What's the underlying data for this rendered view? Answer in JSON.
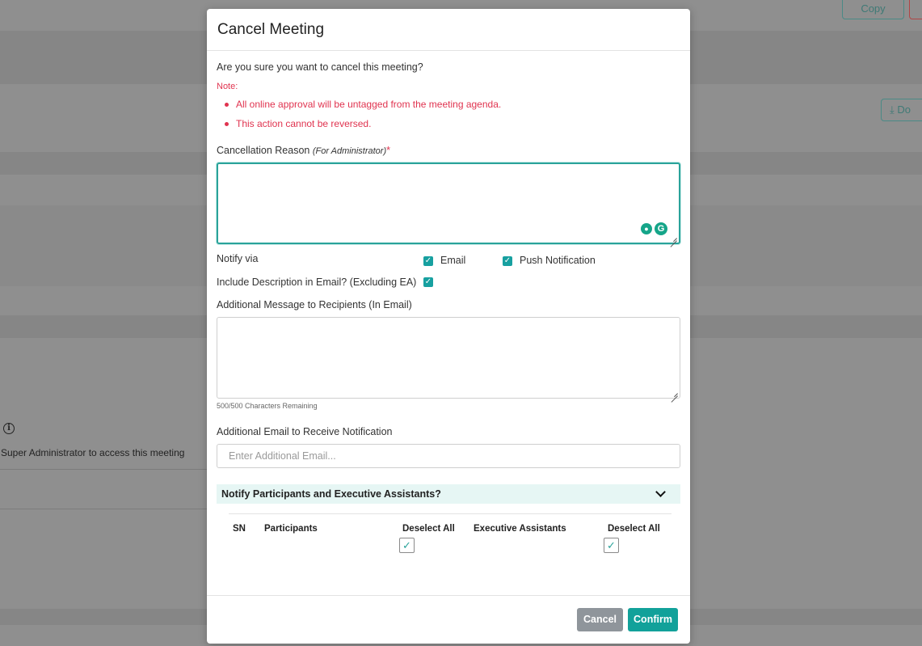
{
  "background": {
    "copy_label": "Copy",
    "download_label": "Do",
    "access_text": "Super Administrator to access this meeting"
  },
  "modal": {
    "title": "Cancel Meeting",
    "question": "Are you sure you want to cancel this meeting?",
    "note_title": "Note:",
    "notes": [
      "All online approval will be untagged from the meeting agenda.",
      "This action cannot be reversed."
    ],
    "reason_label": "Cancellation Reason",
    "reason_sublabel": "(For Administrator)",
    "required_mark": "*",
    "reason_value": "",
    "notify_label": "Notify via",
    "notify_email_label": "Email",
    "notify_email_checked": true,
    "notify_push_label": "Push Notification",
    "notify_push_checked": true,
    "include_desc_label": "Include Description in Email? (Excluding EA)",
    "include_desc_checked": true,
    "additional_msg_label": "Additional Message to Recipients (In Email)",
    "additional_msg_value": "",
    "chars_remaining": "500/500 Characters Remaining",
    "additional_email_label": "Additional Email to Receive Notification",
    "additional_email_placeholder": "Enter Additional Email...",
    "accordion_title": "Notify Participants and Executive Assistants?",
    "table": {
      "col_sn": "SN",
      "col_participants": "Participants",
      "participants_deselect": "Deselect All",
      "col_ea": "Executive Assistants",
      "ea_deselect": "Deselect All",
      "participants_all_checked": true,
      "ea_all_checked": true
    },
    "cancel_label": "Cancel",
    "confirm_label": "Confirm"
  },
  "colors": {
    "accent": "#12a19a",
    "danger": "#e0334f",
    "overlay": "#8f8f8f",
    "cancel_button": "#8f959b"
  },
  "icons": {
    "checkbox": "check-mark",
    "chevron": "chevron-down",
    "info": "info-circle",
    "download": "download-icon",
    "grammarly": "grammarly-g",
    "assistant": "bulb-icon"
  }
}
